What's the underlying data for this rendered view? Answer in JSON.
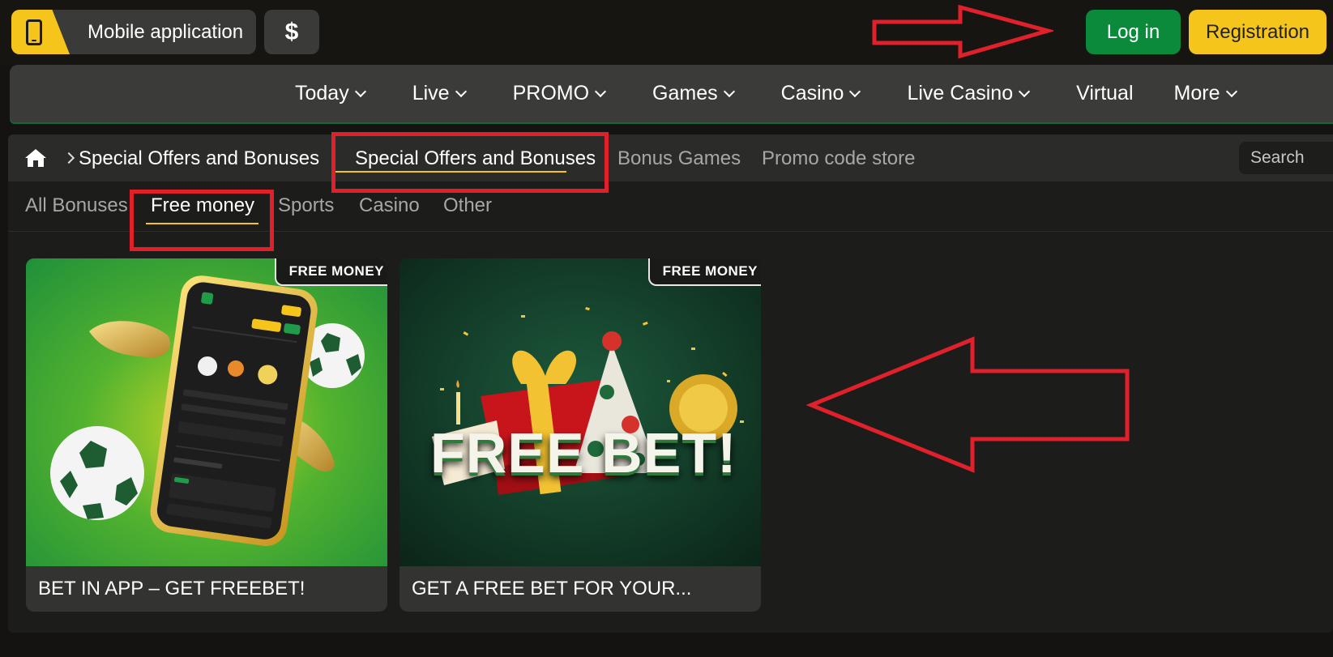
{
  "header": {
    "mobile_app_label": "Mobile application",
    "currency_symbol": "$",
    "login_label": "Log in",
    "registration_label": "Registration"
  },
  "nav": {
    "items": [
      {
        "label": "Today",
        "dropdown": true
      },
      {
        "label": "Live",
        "dropdown": true
      },
      {
        "label": "PROMO",
        "dropdown": true
      },
      {
        "label": "Games",
        "dropdown": true
      },
      {
        "label": "Casino",
        "dropdown": true
      },
      {
        "label": "Live Casino",
        "dropdown": true
      },
      {
        "label": "Virtual",
        "dropdown": false
      },
      {
        "label": "More",
        "dropdown": true
      }
    ]
  },
  "breadcrumb": {
    "current": "Special Offers and Bonuses"
  },
  "subtabs": [
    {
      "label": "Special Offers and Bonuses",
      "active": true
    },
    {
      "label": "Bonus Games",
      "active": false
    },
    {
      "label": "Promo code store",
      "active": false
    }
  ],
  "search": {
    "placeholder": "Search"
  },
  "filters": [
    {
      "label": "All Bonuses",
      "active": false
    },
    {
      "label": "Free money",
      "active": true
    },
    {
      "label": "Sports",
      "active": false
    },
    {
      "label": "Casino",
      "active": false
    },
    {
      "label": "Other",
      "active": false
    }
  ],
  "cards": [
    {
      "badge": "FREE MONEY",
      "title": "BET IN APP – GET FREEBET!"
    },
    {
      "badge": "FREE MONEY",
      "title": "GET A FREE BET FOR YOUR...",
      "image_text": "FREE BET!"
    }
  ],
  "colors": {
    "accent_yellow": "#f6c51c",
    "login_green": "#0b8a3c",
    "annotation_red": "#e0212b"
  }
}
